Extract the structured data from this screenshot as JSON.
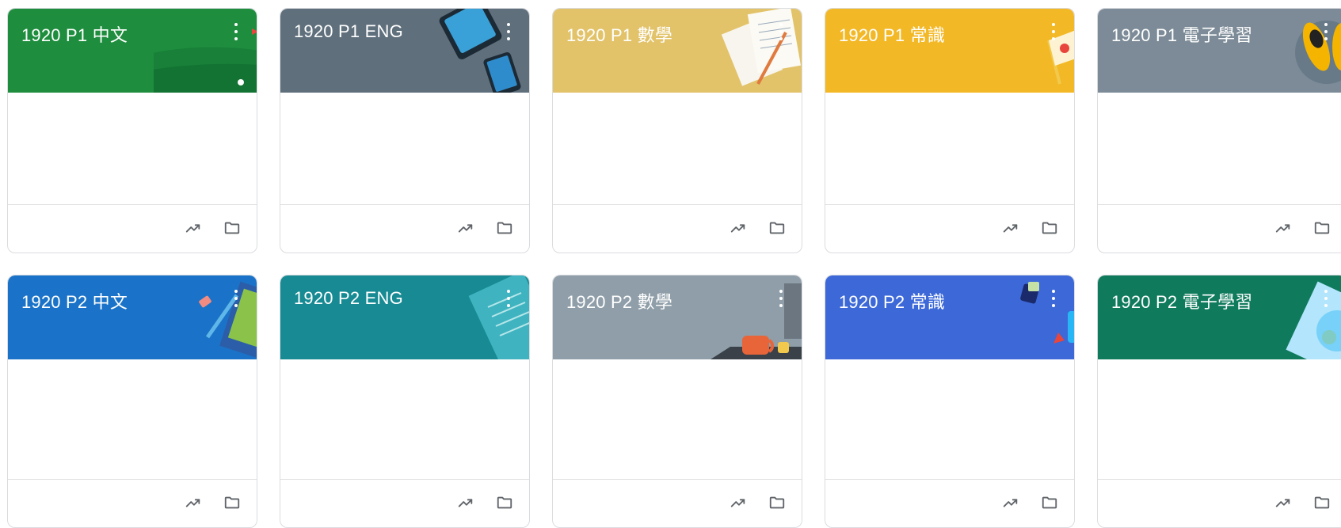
{
  "classes": [
    {
      "title": "1920 P1 中文",
      "color": "#1e8e3e",
      "theme": "field"
    },
    {
      "title": "1920 P1 ENG",
      "color": "#5f6f7c",
      "theme": "tablet"
    },
    {
      "title": "1920 P1 數學",
      "color": "#e2c36a",
      "theme": "papers"
    },
    {
      "title": "1920 P1 常識",
      "color": "#f3b826",
      "theme": "flag"
    },
    {
      "title": "1920 P1 電子學習",
      "color": "#7c8b97",
      "theme": "shoes"
    },
    {
      "title": "1920 P2 中文",
      "color": "#1a73c8",
      "theme": "pencil"
    },
    {
      "title": "1920 P2 ENG",
      "color": "#178a93",
      "theme": "paper"
    },
    {
      "title": "1920 P2 數學",
      "color": "#8f9ea8",
      "theme": "mug"
    },
    {
      "title": "1920 P2 常識",
      "color": "#3c68d8",
      "theme": "dice"
    },
    {
      "title": "1920 P2 電子學習",
      "color": "#0f7a5c",
      "theme": "globe"
    }
  ],
  "icons": {
    "menu": "more-vert-icon",
    "trend": "trending-up-icon",
    "folder": "folder-icon"
  }
}
